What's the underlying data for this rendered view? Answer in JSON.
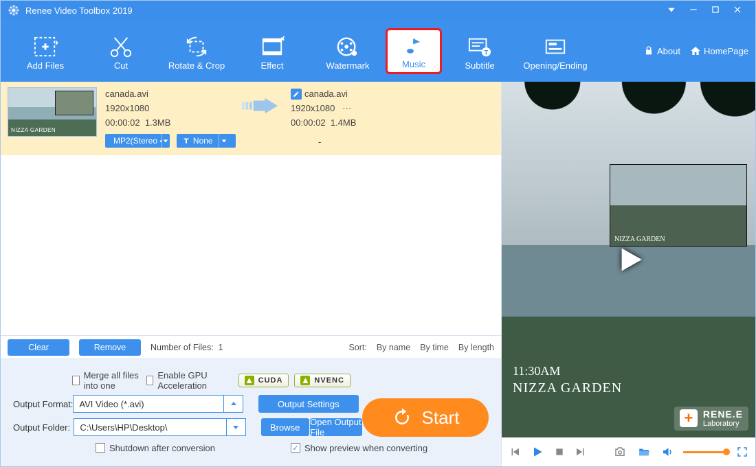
{
  "app": {
    "title": "Renee Video Toolbox 2019"
  },
  "toolbar": {
    "items": [
      {
        "id": "add-files",
        "label": "Add Files"
      },
      {
        "id": "cut",
        "label": "Cut"
      },
      {
        "id": "rotate-crop",
        "label": "Rotate & Crop"
      },
      {
        "id": "effect",
        "label": "Effect"
      },
      {
        "id": "watermark",
        "label": "Watermark"
      },
      {
        "id": "music",
        "label": "Music"
      },
      {
        "id": "subtitle",
        "label": "Subtitle"
      },
      {
        "id": "opening-ending",
        "label": "Opening/Ending"
      }
    ],
    "selected": "music",
    "about": "About",
    "homepage": "HomePage"
  },
  "file": {
    "src": {
      "name": "canada.avi",
      "dims": "1920x1080",
      "duration": "00:00:02",
      "size": "1.3MB"
    },
    "dst": {
      "name": "canada.avi",
      "dims": "1920x1080",
      "more": "···",
      "duration": "00:00:02",
      "size": "1.4MB",
      "dash": "-"
    },
    "audio_pill": "MP2(Stereo 4",
    "subtitle_pill": "None"
  },
  "list_actions": {
    "clear": "Clear",
    "remove": "Remove",
    "count_label": "Number of Files:",
    "count": "1",
    "sort_label": "Sort:",
    "by_name": "By name",
    "by_time": "By time",
    "by_length": "By length"
  },
  "bottom": {
    "merge": "Merge all files into one",
    "gpu": "Enable GPU Acceleration",
    "cuda": "CUDA",
    "nvenc": "NVENC",
    "output_format_label": "Output Format:",
    "output_format_value": "AVI Video (*.avi)",
    "output_settings": "Output Settings",
    "output_folder_label": "Output Folder:",
    "output_folder_value": "C:\\Users\\HP\\Desktop\\",
    "browse": "Browse",
    "open_output": "Open Output File",
    "shutdown": "Shutdown after conversion",
    "preview": "Show preview when converting",
    "start": "Start"
  },
  "preview": {
    "time": "11:30AM",
    "title": "NIZZA GARDEN",
    "pip": "NIZZA GARDEN",
    "brand_top": "RENE.E",
    "brand_sub": "Laboratory",
    "thumb_label": "NIZZA GARDEN"
  }
}
